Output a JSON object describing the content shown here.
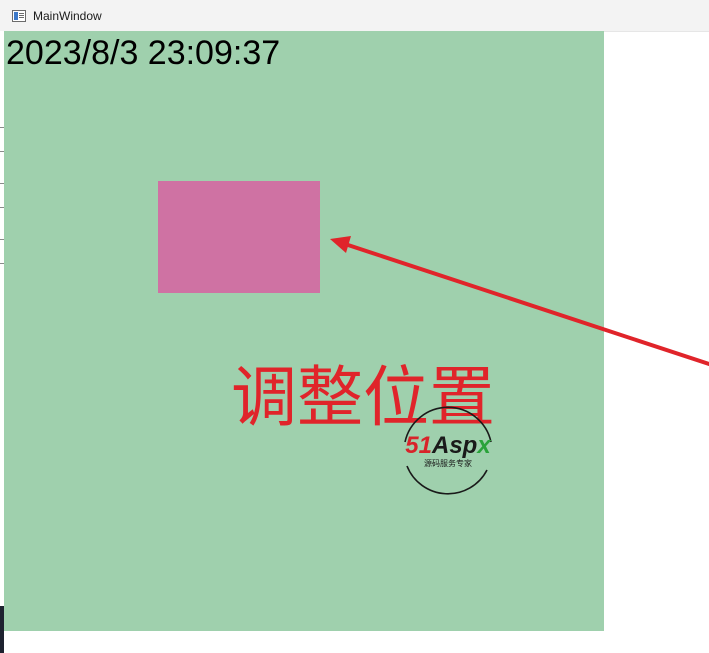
{
  "window": {
    "title": "MainWindow"
  },
  "canvas": {
    "background": "#9fd0ad",
    "clock_text": "2023/8/3 23:09:37",
    "rect_color": "#cf72a3",
    "label_text": "调整位置",
    "label_color": "#e0242a",
    "arrow_color": "#e0242a"
  },
  "logo": {
    "brand_part1": "51",
    "brand_part2": "Asp",
    "brand_part3": "x",
    "subtitle": "源码服务专家"
  }
}
